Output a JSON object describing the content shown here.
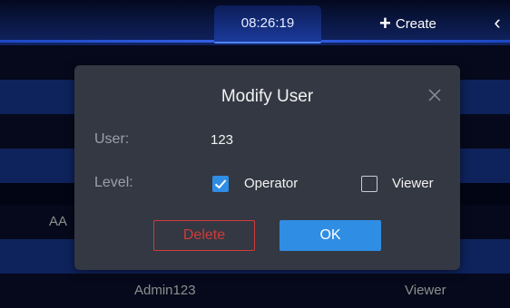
{
  "header": {
    "time": "08:26:19",
    "create_label": "Create",
    "create_icon": "plus-icon",
    "back_icon": "chevron-left-icon"
  },
  "list": {
    "rows": [
      {
        "name": "",
        "level": ""
      },
      {
        "name": "",
        "level": ""
      },
      {
        "name": "",
        "level": ""
      },
      {
        "name": "",
        "level": ""
      },
      {
        "name": "AA",
        "level": ""
      },
      {
        "name": "",
        "level": ""
      },
      {
        "name": "Admin123",
        "level": "Viewer"
      }
    ]
  },
  "modal": {
    "title": "Modify User",
    "user_label": "User:",
    "user_value": "123",
    "level_label": "Level:",
    "options": [
      {
        "label": "Operator",
        "checked": true
      },
      {
        "label": "Viewer",
        "checked": false
      }
    ],
    "delete_label": "Delete",
    "ok_label": "OK"
  },
  "colors": {
    "accent": "#2f8de4",
    "danger": "#d23a3a",
    "modal_bg": "#343842",
    "row_alt": "#1a3ea8"
  }
}
